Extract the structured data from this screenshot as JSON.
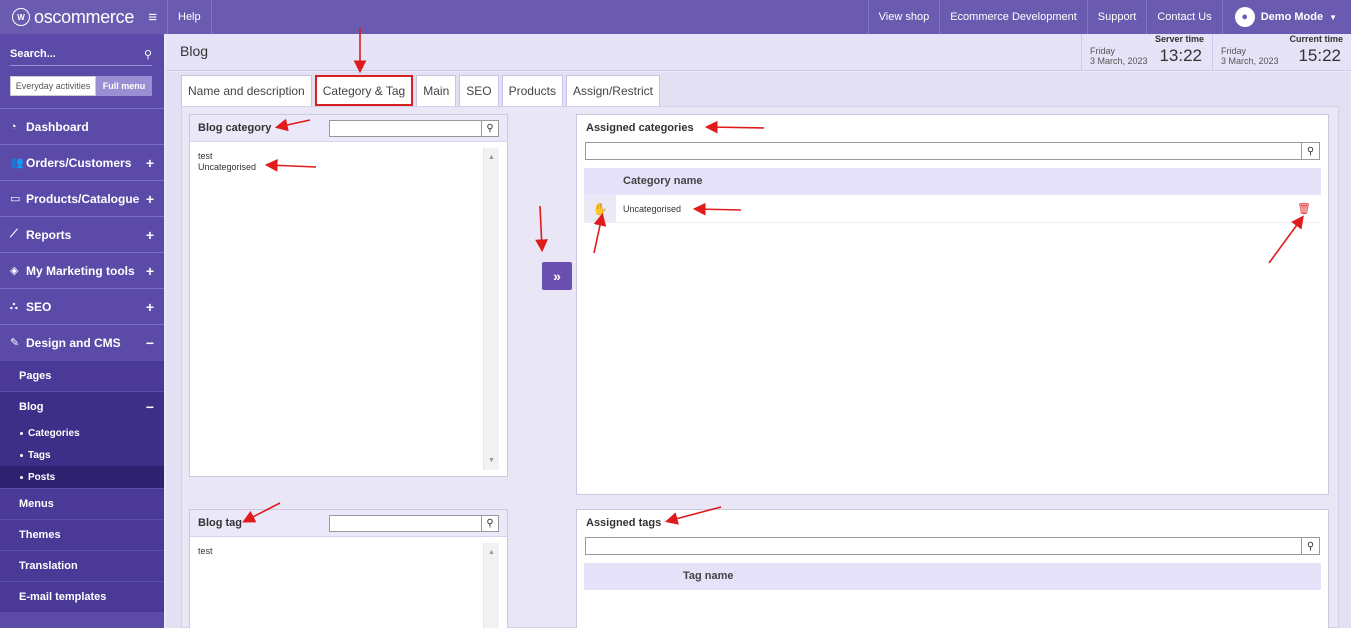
{
  "topbar": {
    "brand": "oscommerce",
    "help": "Help",
    "links": [
      "View shop",
      "Ecommerce Development",
      "Support",
      "Contact Us"
    ],
    "user": "Demo Mode"
  },
  "sidebar": {
    "search_placeholder": "Search...",
    "mode_everyday": "Everyday activities",
    "mode_full": "Full menu",
    "items": [
      {
        "label": "Dashboard",
        "icon": "dashboard-icon",
        "toggle": ""
      },
      {
        "label": "Orders/Customers",
        "icon": "users-icon",
        "toggle": "+"
      },
      {
        "label": "Products/Catalogue",
        "icon": "folder-icon",
        "toggle": "+"
      },
      {
        "label": "Reports",
        "icon": "chart-icon",
        "toggle": "+"
      },
      {
        "label": "My Marketing tools",
        "icon": "tag-icon",
        "toggle": "+"
      },
      {
        "label": "SEO",
        "icon": "sitemap-icon",
        "toggle": "+"
      },
      {
        "label": "Design and CMS",
        "icon": "brush-icon",
        "toggle": "−"
      }
    ],
    "design_sub": {
      "pages": "Pages",
      "blog": "Blog",
      "blog_toggle": "−",
      "blog_children": [
        "Categories",
        "Tags",
        "Posts"
      ],
      "after": [
        "Menus",
        "Themes",
        "Translation",
        "E-mail templates"
      ]
    }
  },
  "header": {
    "title": "Blog",
    "server_caption": "Server time",
    "server_day": "Friday",
    "server_date": "3 March, 2023",
    "server_clock": "13:22",
    "current_caption": "Current time",
    "current_day": "Friday",
    "current_date": "3 March, 2023",
    "current_clock": "15:22"
  },
  "tabs": [
    "Name and description",
    "Category & Tag",
    "Main",
    "SEO",
    "Products",
    "Assign/Restrict"
  ],
  "active_tab": "Category & Tag",
  "blog_category": {
    "title": "Blog category",
    "items": [
      "test",
      "Uncategorised"
    ]
  },
  "blog_tag": {
    "title": "Blog tag",
    "items": [
      "test"
    ]
  },
  "assigned_categories": {
    "title": "Assigned categories",
    "column": "Category name",
    "rows": [
      "Uncategorised"
    ]
  },
  "assigned_tags": {
    "title": "Assigned tags",
    "column": "Tag name"
  },
  "colors": {
    "topbar": "#6b5bb0",
    "sidebar": "#5b4aa8",
    "accent_button": "#6b4fb0",
    "annotation_red": "#e01b1b"
  }
}
